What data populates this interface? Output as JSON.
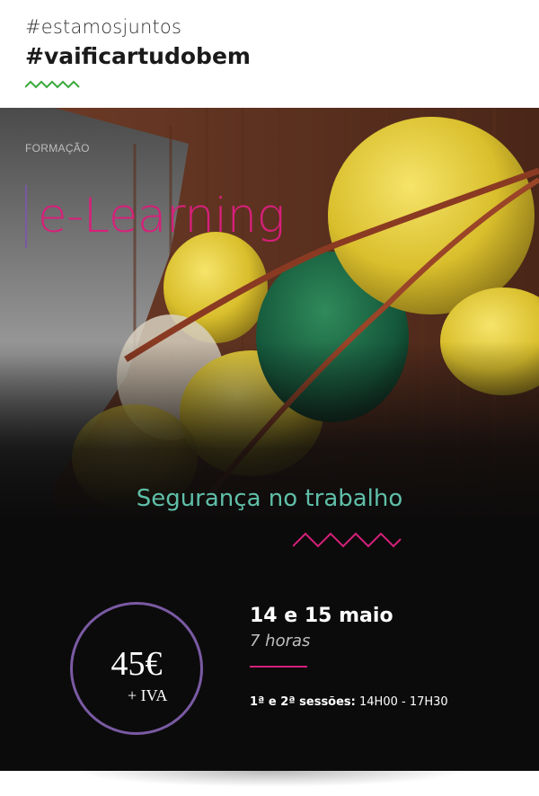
{
  "header": {
    "hashtag_primary": "#estamosjuntos",
    "hashtag_secondary": "#vaificartudobem"
  },
  "hero": {
    "category": "FORMAÇÃO",
    "title": "e-Learning",
    "course_name": "Segurança no trabalho"
  },
  "details": {
    "price": "45€",
    "vat": "+ IVA",
    "date": "14 e 15 maio",
    "duration": "7 horas",
    "sessions_label": "1ª e 2ª sessões:",
    "sessions_time": " 14H00 - 17H30"
  },
  "colors": {
    "accent_pink": "#d6207a",
    "accent_purple": "#7a5aa3",
    "accent_teal": "#5fbfa8",
    "accent_green": "#3aa83a",
    "panel_bg": "#0b0b0b"
  },
  "icons": [
    "zigzag-green-icon",
    "zigzag-pink-icon"
  ]
}
